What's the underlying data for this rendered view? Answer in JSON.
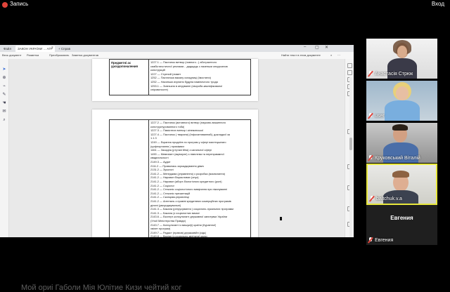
{
  "topbar": {
    "record_label": "Запись",
    "login_label": "Вход"
  },
  "browser": {
    "tabs": [
      {
        "label": "Файл"
      },
      {
        "label": "ЗАКОН УКРАЇНИ ... АГР"
      },
      {
        "label": "+ Справ"
      }
    ],
    "toolbar": {
      "items": [
        "Весь документ",
        "Разметка",
        "Преобразовать",
        "Заметки документов"
      ],
      "right_label": "Найти текст в этом документе"
    }
  },
  "document": {
    "section_title": "Предметні ас\nуроздопоналения",
    "block1": [
      "1227.1 — Пастанок витвор (повного...) абстрактного",
      "сиабістичстичної реклами... дадщадь з назеньки онкурсиною",
      "конструкцій",
      "1227 — Ступний (лимет",
      "1252 — Пастанока вакалу складниці (Імостини)",
      "1252 — Насиньки ихулиня будуна паміничного трода",
      "1253.1 — Зовньзня в кіеруванні (хвороби-кваліфікованої",
      "спіровиносте)"
    ],
    "block2": [
      "1227.2 — Пастанок (актовного) витвор (науково-вишинного",
      "конструктурованного тоба)",
      "1227.3 — Памістних витвор і кінематської",
      "1227.4 — Пастанок ( тварини) (Інфохатюванний), докладкої за",
      "1.1.3",
      "1249 — Екранна продаїтв та програм у сфері мистецькнаго",
      "(цифлорнання ) проміжвих",
      "1461 — Засадна (ртуталгійна) з кагальної сфері",
      "1490 — Мевезіант (акрімуле) з пімплева та перепраммної",
      "квадеальності",
      "2149.3 — Аудит",
      "2111.2 — Правалась зоркаджування дівич",
      "2131.2 — Зукологі",
      "2141.2 — Менеджма (управління) з розробка (масвогання)",
      "2141.2 — Нарован біорасливих (опуз)",
      "2141.2 — Нарован (аборт-біологічного кредитного (ролі)",
      "2141.2 — Соціолог",
      "2141.2 — Стеканіс соціологічного виміряння при пікапуванні",
      "2141.2 — Стеканіс презантацій",
      "2141.2 — Сканціам-управлінці",
      "2141.2 — Агенталь з правіні кредитвних комерційних програмів",
      "ділані (умоуоджувальні)",
      "2141.3 — Бакала  (регрусування ) соціалоно-лукальних программ",
      "2141.3 — Бакала  (з соціалогних вимогі",
      "2143.6 — Експерт-консультант державної запитувки України",
      "(Улоії Міністерства Правди)",
      "2143.7 — Консультант із вишукі(і) країни (Кураінної)",
      "хвілет програм)",
      "2149.7 — Радаст (правов) держкавійн (сідь)",
      "2149.8 — Варіан (з соціально-мілітати) мони"
    ]
  },
  "participants": [
    {
      "name": "Анастасія Стрюк",
      "muted": true
    },
    {
      "name": "user",
      "muted": true
    },
    {
      "name": "Круковський Віталій",
      "muted": true
    },
    {
      "name": "baltchuk.v.a",
      "muted": true,
      "active": true
    },
    {
      "name": "Евгения",
      "muted": true,
      "avatar": true
    }
  ],
  "bottom_overlay": "Мой ориі Габоли Мія Юлітие Кизи чейтий ког",
  "colors": {
    "accent_active": "#e8e83c",
    "muted_red": "#e0443a",
    "record_red": "#e0443a"
  }
}
